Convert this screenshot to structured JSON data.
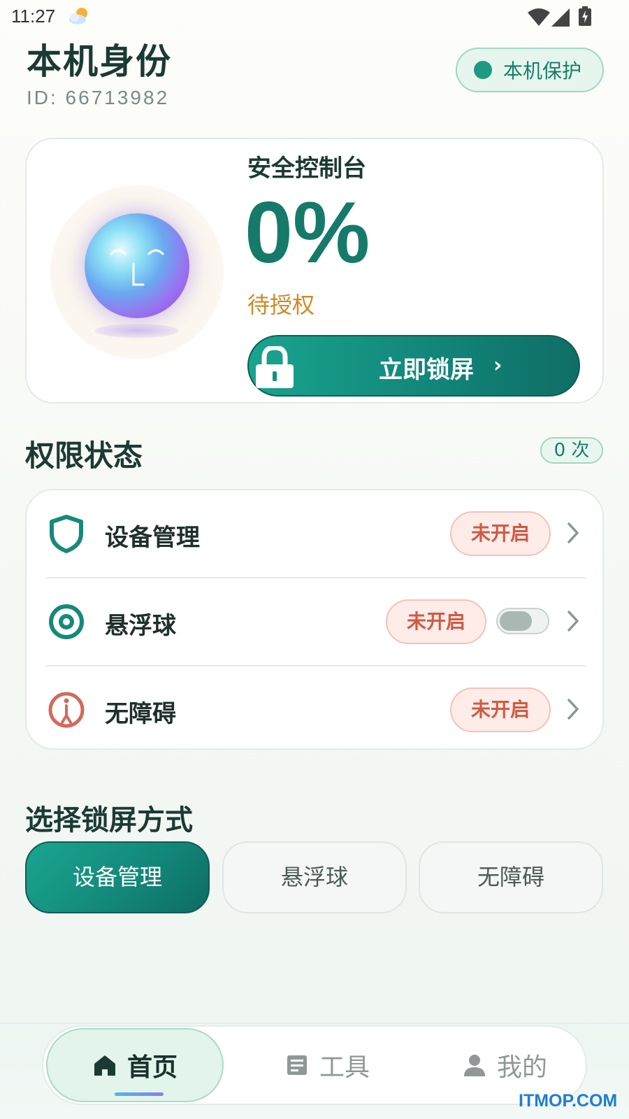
{
  "status_bar": {
    "time": "11:27",
    "weather_icon": "partly-cloudy-icon",
    "wifi_icon": "wifi-icon",
    "signal_icon": "cell-signal-icon",
    "battery_icon": "battery-charging-icon"
  },
  "header": {
    "title": "本机身份",
    "device_id": "ID: 66713982",
    "protect_badge": "本机保护",
    "protect_dot_color": "#1e9a80"
  },
  "console": {
    "title": "安全控制台",
    "percent": "0%",
    "status": "待授权",
    "status_color": "#d08a26",
    "lock_button": "立即锁屏",
    "lock_arrow": "›",
    "avatar_icon": "ai-orb-avatar-icon"
  },
  "permissions": {
    "title": "权限状态",
    "count": "0 次",
    "items": [
      {
        "label": "设备管理",
        "status": "未开启",
        "icon": "shield-icon",
        "has_toggle": false
      },
      {
        "label": "悬浮球",
        "status": "未开启",
        "icon": "target-icon",
        "has_toggle": true,
        "toggle_on": false
      },
      {
        "label": "无障碍",
        "status": "未开启",
        "icon": "accessibility-icon",
        "has_toggle": false
      }
    ]
  },
  "lock_method": {
    "title": "选择锁屏方式",
    "options": [
      "设备管理",
      "悬浮球",
      "无障碍"
    ],
    "selected": "设备管理"
  },
  "bottom_nav": {
    "items": [
      {
        "label": "首页",
        "icon": "home-icon",
        "active": true
      },
      {
        "label": "工具",
        "icon": "tools-icon",
        "active": false
      },
      {
        "label": "我的",
        "icon": "profile-icon",
        "active": false
      }
    ]
  },
  "watermark": "ITMOP.COM",
  "colors": {
    "accent": "#167a6a",
    "warning_badge": "#d05a44"
  }
}
